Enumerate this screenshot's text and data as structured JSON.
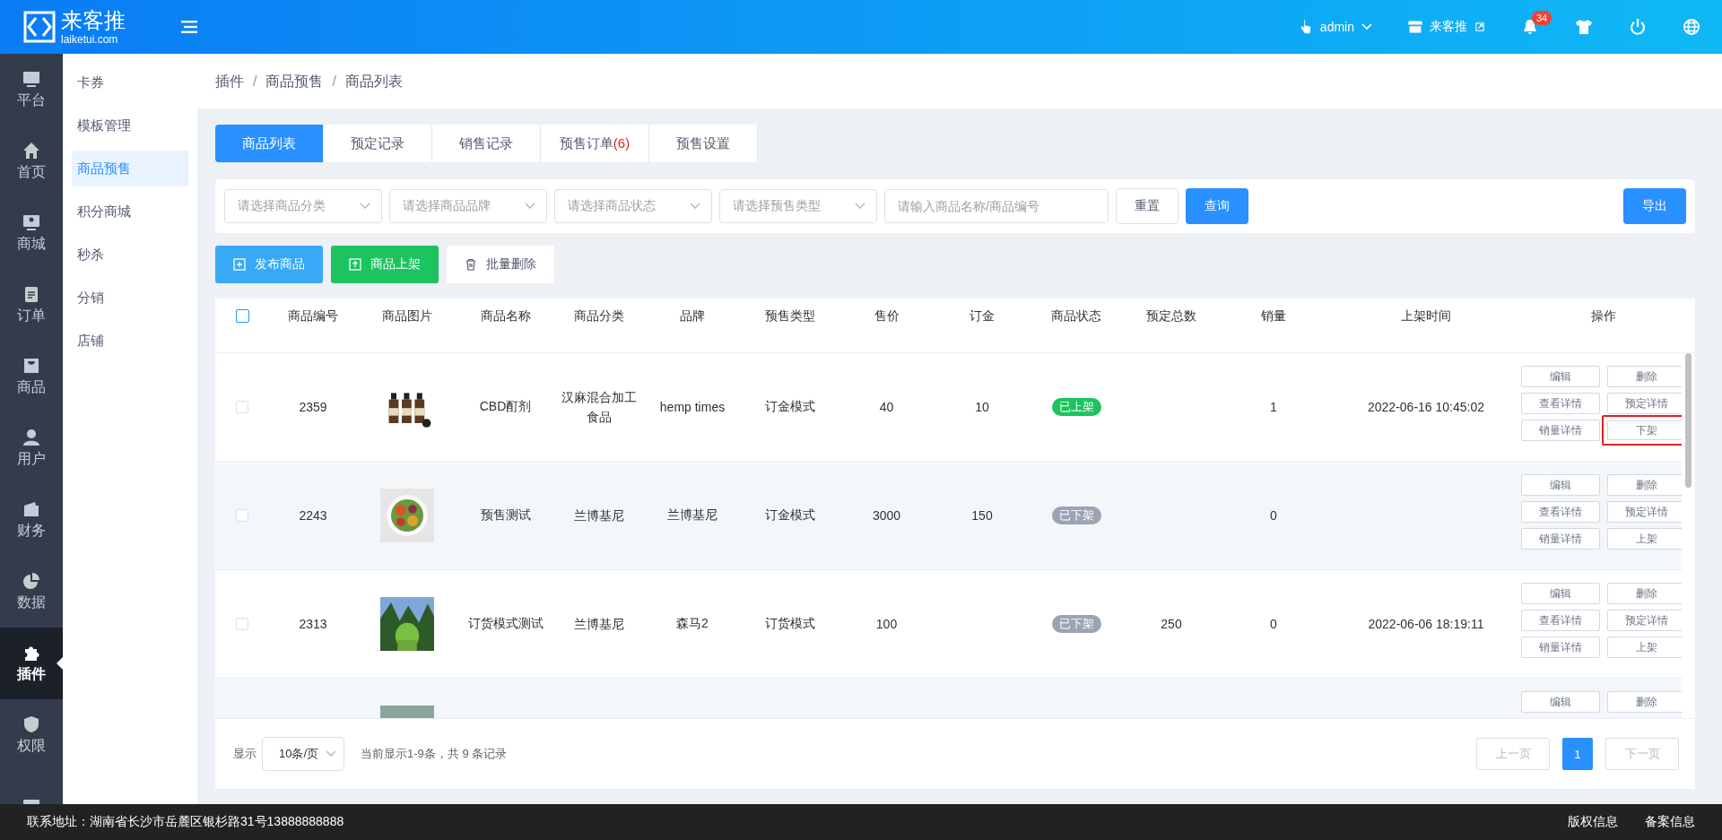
{
  "header": {
    "logo_name": "来客推",
    "logo_domain": "laiketui.com",
    "user": "admin",
    "store": "来客推",
    "notifications": "34"
  },
  "rail": [
    {
      "label": "平台",
      "selected": false
    },
    {
      "label": "首页",
      "selected": false
    },
    {
      "label": "商城",
      "selected": false
    },
    {
      "label": "订单",
      "selected": false
    },
    {
      "label": "商品",
      "selected": false
    },
    {
      "label": "用户",
      "selected": false
    },
    {
      "label": "财务",
      "selected": false
    },
    {
      "label": "数据",
      "selected": false
    },
    {
      "label": "插件",
      "selected": true
    },
    {
      "label": "权限",
      "selected": false
    },
    {
      "selected": false
    }
  ],
  "submenu": [
    {
      "label": "卡券",
      "selected": false
    },
    {
      "label": "模板管理",
      "selected": false
    },
    {
      "label": "商品预售",
      "selected": true
    },
    {
      "label": "积分商城",
      "selected": false
    },
    {
      "label": "秒杀",
      "selected": false
    },
    {
      "label": "分销",
      "selected": false
    },
    {
      "label": "店铺",
      "selected": false
    }
  ],
  "breadcrumb": {
    "items": [
      "插件",
      "商品预售",
      "商品列表"
    ],
    "separator": "/"
  },
  "tabs": [
    {
      "label": "商品列表",
      "selected": true
    },
    {
      "label": "预定记录",
      "selected": false
    },
    {
      "label": "销售记录",
      "selected": false
    },
    {
      "label": "预售订单",
      "count": "(6)",
      "selected": false
    },
    {
      "label": "预售设置",
      "selected": false
    }
  ],
  "filters": {
    "selects": [
      "请选择商品分类",
      "请选择商品品牌",
      "请选择商品状态",
      "请选择预售类型"
    ],
    "search_placeholder": "请输入商品名称/商品编号",
    "reset": "重置",
    "query": "查询",
    "export": "导出"
  },
  "actions": [
    {
      "label": "发布商品",
      "kind": "publish"
    },
    {
      "label": "商品上架",
      "kind": "shelve"
    },
    {
      "label": "批量删除",
      "kind": "delete"
    }
  ],
  "table": {
    "select_all_checked": false,
    "columns": [
      "商品编号",
      "商品图片",
      "商品名称",
      "商品分类",
      "品牌",
      "预售类型",
      "售价",
      "订金",
      "商品状态",
      "预定总数",
      "销量",
      "上架时间",
      "操作"
    ],
    "rows": [
      {
        "id": "2359",
        "name": "CBD酊剂",
        "category": "汉麻混合加工食品",
        "brand": "hemp times",
        "type": "订金模式",
        "price": "40",
        "deposit": "10",
        "status": {
          "label": "已上架",
          "on": true
        },
        "reserved": "",
        "sales": "1",
        "time": "2022-06-16 10:45:02",
        "checked": false,
        "actions": [
          {
            "label": "编辑",
            "highlighted": false
          },
          {
            "label": "删除",
            "highlighted": false
          },
          {
            "label": "查看详情",
            "highlighted": false
          },
          {
            "label": "预定详情",
            "highlighted": false
          },
          {
            "label": "销量详情",
            "highlighted": false
          },
          {
            "label": "下架",
            "highlighted": true
          }
        ]
      },
      {
        "id": "2243",
        "name": "预售测试",
        "category": "兰博基尼",
        "brand": "兰博基尼",
        "type": "订金模式",
        "price": "3000",
        "deposit": "150",
        "status": {
          "label": "已下架",
          "on": false
        },
        "reserved": "",
        "sales": "0",
        "time": "",
        "checked": false,
        "actions": [
          {
            "label": "编辑",
            "highlighted": false
          },
          {
            "label": "删除",
            "highlighted": false
          },
          {
            "label": "查看详情",
            "highlighted": false
          },
          {
            "label": "预定详情",
            "highlighted": false
          },
          {
            "label": "销量详情",
            "highlighted": false
          },
          {
            "label": "上架",
            "highlighted": false
          }
        ]
      },
      {
        "id": "2313",
        "name": "订货模式测试",
        "category": "兰博基尼",
        "brand": "森马2",
        "type": "订货模式",
        "price": "100",
        "deposit": "",
        "status": {
          "label": "已下架",
          "on": false
        },
        "reserved": "250",
        "sales": "0",
        "time": "2022-06-06 18:19:11",
        "checked": false,
        "actions": [
          {
            "label": "编辑",
            "highlighted": false
          },
          {
            "label": "删除",
            "highlighted": false
          },
          {
            "label": "查看详情",
            "highlighted": false
          },
          {
            "label": "预定详情",
            "highlighted": false
          },
          {
            "label": "销量详情",
            "highlighted": false
          },
          {
            "label": "上架",
            "highlighted": false
          }
        ]
      },
      {
        "actions": [
          {
            "label": "编辑",
            "highlighted": false
          },
          {
            "label": "删除",
            "highlighted": false
          }
        ]
      }
    ]
  },
  "pagination": {
    "show_label": "显示",
    "page_size": "10条/页",
    "summary": "当前显示1-9条，共 9 条记录",
    "prev": "上一页",
    "pages": [
      {
        "label": "1",
        "selected": true
      }
    ],
    "next": "下一页"
  },
  "footer": {
    "address": "联系地址：湖南省长沙市岳麓区银杉路31号13888888888",
    "links": [
      "版权信息",
      "备案信息"
    ]
  }
}
